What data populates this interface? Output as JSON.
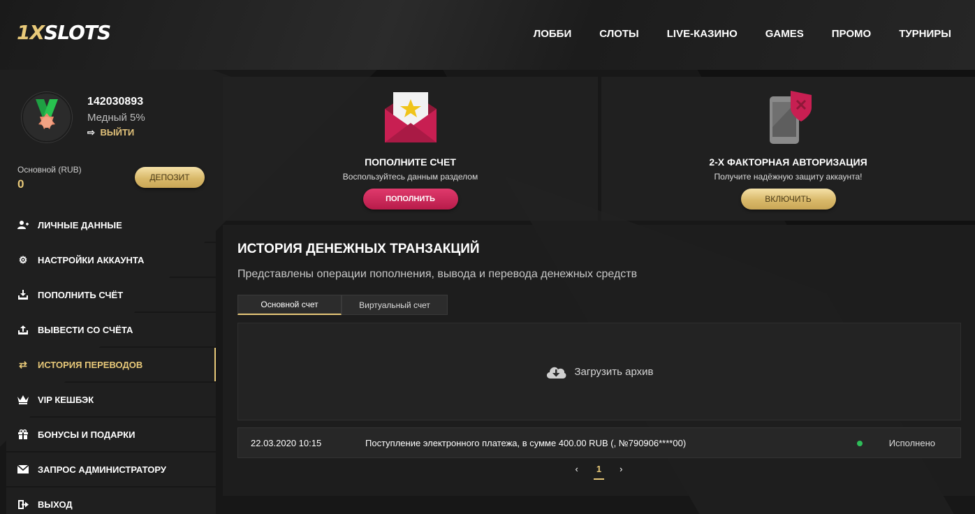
{
  "header": {
    "logo_part1": "1X",
    "logo_part2": "SLOTS",
    "nav": [
      "ЛОББИ",
      "СЛОТЫ",
      "LIVE-КАЗИНО",
      "GAMES",
      "ПРОМО",
      "ТУРНИРЫ"
    ]
  },
  "profile": {
    "user_id": "142030893",
    "rank": "Медный 5%",
    "logout_label": "ВЫЙТИ",
    "balance_label": "Основной (RUB)",
    "balance_value": "0",
    "deposit_label": "ДЕПОЗИТ"
  },
  "menu": [
    {
      "label": "ЛИЧНЫЕ ДАННЫЕ",
      "icon": "user-add-icon"
    },
    {
      "label": "НАСТРОЙКИ АККАУНТА",
      "icon": "gears-icon"
    },
    {
      "label": "ПОПОЛНИТЬ СЧЁТ",
      "icon": "download-icon"
    },
    {
      "label": "ВЫВЕСТИ СО СЧЁТА",
      "icon": "upload-icon"
    },
    {
      "label": "ИСТОРИЯ ПЕРЕВОДОВ",
      "icon": "transfer-icon",
      "active": true
    },
    {
      "label": "VIP КЕШБЭК",
      "icon": "crown-icon"
    },
    {
      "label": "БОНУСЫ И ПОДАРКИ",
      "icon": "gift-icon"
    },
    {
      "label": "ЗАПРОС АДМИНИСТРАТОРУ",
      "icon": "envelope-icon"
    },
    {
      "label": "ВЫХОД",
      "icon": "exit-icon"
    }
  ],
  "cards": {
    "deposit": {
      "title": "ПОПОЛНИТЕ СЧЕТ",
      "subtitle": "Воспользуйтесь данным разделом",
      "button": "ПОПОЛНИТЬ"
    },
    "twofa": {
      "title": "2-Х ФАКТОРНАЯ АВТОРИЗАЦИЯ",
      "subtitle": "Получите надёжную защиту аккаунта!",
      "button": "ВКЛЮЧИТЬ"
    }
  },
  "history": {
    "title": "ИСТОРИЯ ДЕНЕЖНЫХ ТРАНЗАКЦИЙ",
    "subtitle": "Представлены операции пополнения, вывода и перевода денежных средств",
    "tabs": [
      "Основной счет",
      "Виртуальный счет"
    ],
    "archive_label": "Загрузить архив",
    "rows": [
      {
        "date": "22.03.2020 10:15",
        "description": "Поступление электронного платежа, в сумме 400.00 RUB (, №790906****00)",
        "status": "Исполнено"
      }
    ],
    "pager": {
      "prev": "‹",
      "current": "1",
      "next": "›"
    }
  },
  "colors": {
    "gold": "#e8c979",
    "pink": "#c8214f",
    "status_ok": "#2ebd59"
  }
}
